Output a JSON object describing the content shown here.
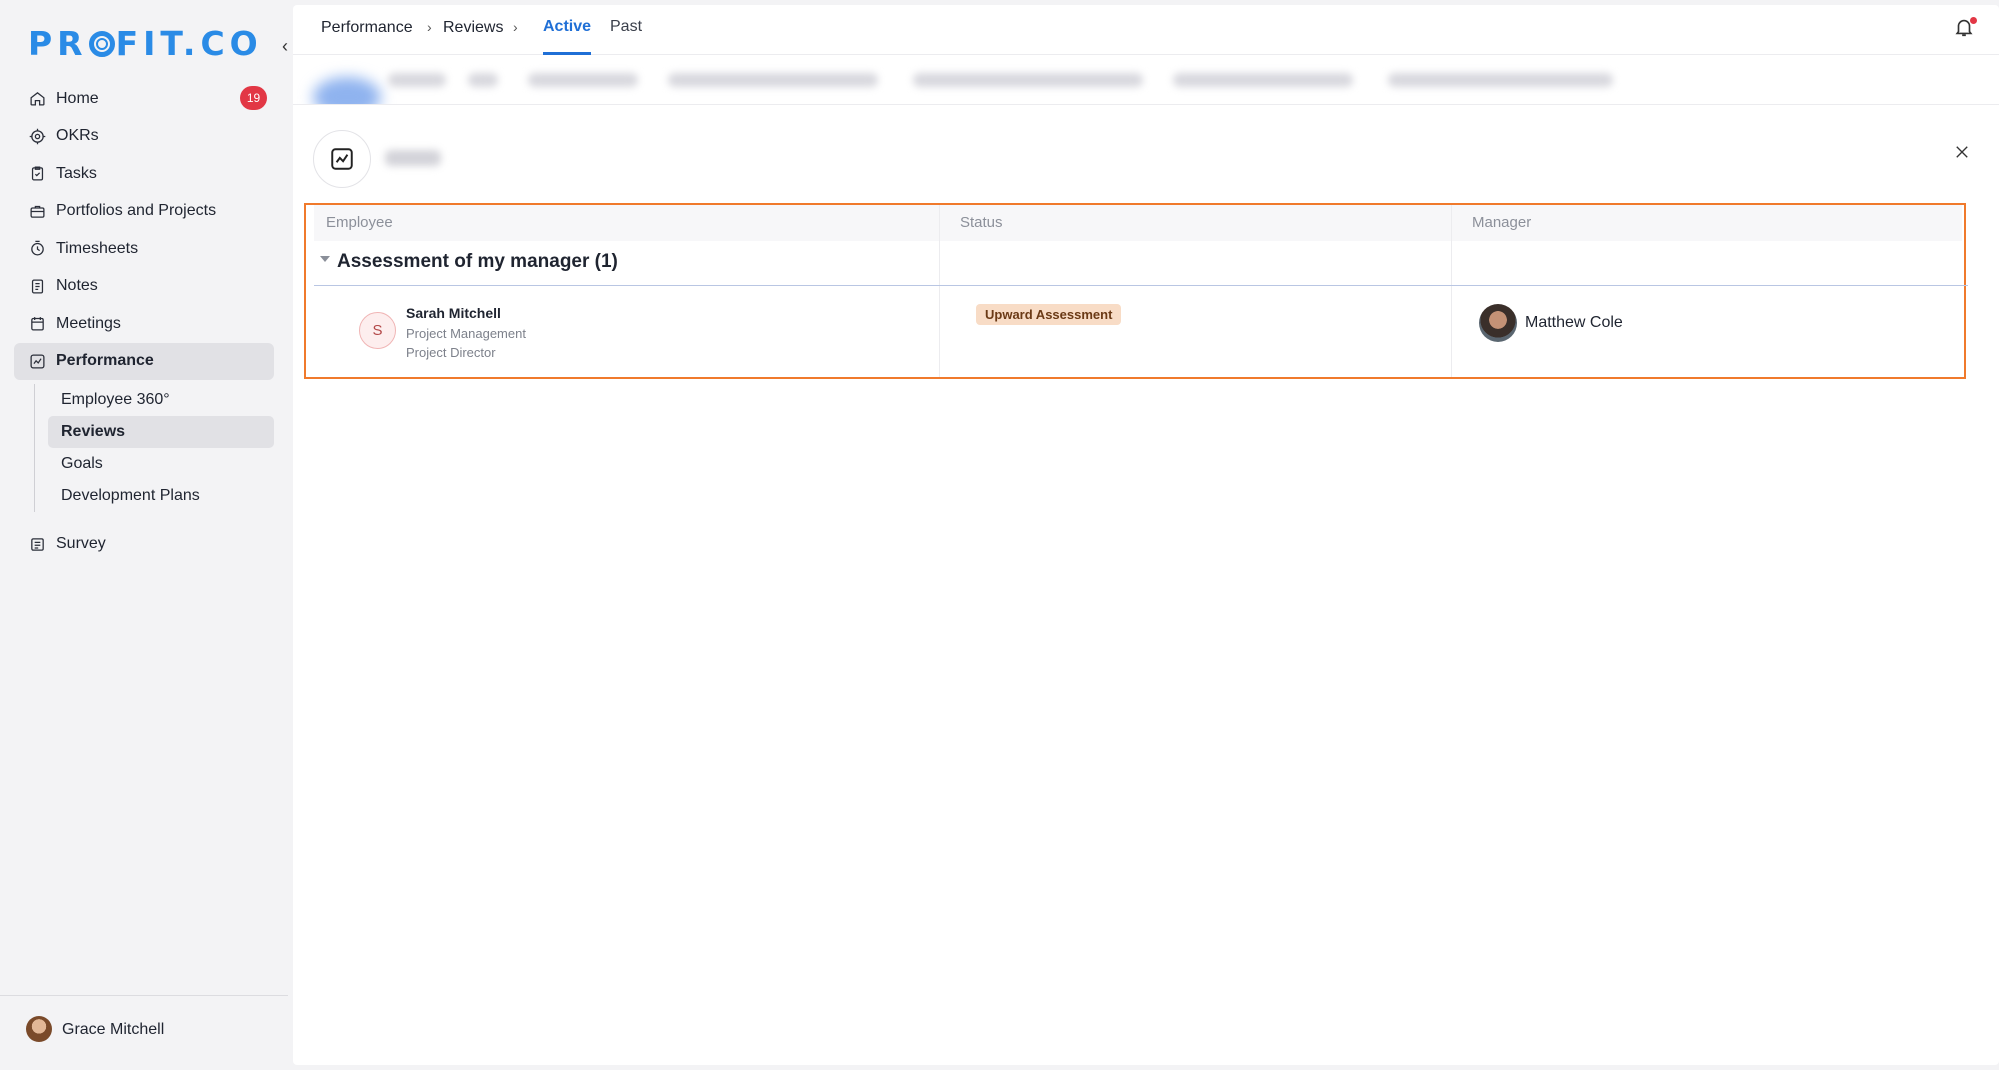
{
  "app": {
    "logo_text": "PROFIT.CO"
  },
  "sidebar": {
    "items": [
      {
        "label": "Home",
        "icon": "home-icon",
        "badge": "19"
      },
      {
        "label": "OKRs",
        "icon": "target-icon"
      },
      {
        "label": "Tasks",
        "icon": "task-icon"
      },
      {
        "label": "Portfolios and Projects",
        "icon": "briefcase-icon"
      },
      {
        "label": "Timesheets",
        "icon": "clock-icon"
      },
      {
        "label": "Notes",
        "icon": "notes-icon"
      },
      {
        "label": "Meetings",
        "icon": "calendar-icon"
      },
      {
        "label": "Performance",
        "icon": "performance-icon",
        "active": true
      }
    ],
    "performance_sub": [
      {
        "label": "Employee 360°"
      },
      {
        "label": "Reviews",
        "active": true
      },
      {
        "label": "Goals"
      },
      {
        "label": "Development Plans"
      }
    ],
    "survey": {
      "label": "Survey",
      "icon": "survey-icon"
    },
    "user": {
      "name": "Grace Mitchell"
    }
  },
  "header": {
    "breadcrumb": [
      "Performance",
      "Reviews"
    ],
    "tabs": [
      {
        "label": "Active",
        "active": true
      },
      {
        "label": "Past"
      }
    ]
  },
  "table": {
    "columns": [
      "Employee",
      "Status",
      "Manager"
    ],
    "group": {
      "title": "Assessment of my manager (1)"
    },
    "rows": [
      {
        "avatar_initial": "S",
        "name": "Sarah Mitchell",
        "department": "Project Management",
        "title": "Project Director",
        "status": "Upward Assessment",
        "manager": "Matthew Cole"
      }
    ]
  },
  "colors": {
    "accent": "#1f6fd6",
    "logo": "#2a8be6",
    "badge": "#e23745",
    "highlight_border": "#f07a2c",
    "status_badge_bg": "#f8dcc6"
  }
}
